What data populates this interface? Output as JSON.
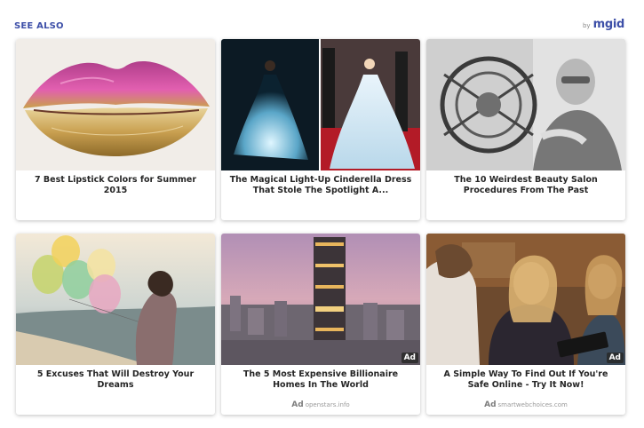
{
  "widget": {
    "heading": "SEE ALSO",
    "by": "by",
    "brand": "mgid",
    "brand_color": "#3d4fa8"
  },
  "cards": [
    {
      "title": "7 Best Lipstick Colors for Summer 2015",
      "ad": false,
      "source": ""
    },
    {
      "title": "The Magical Light-Up Cinderella Dress That Stole The Spotlight A...",
      "ad": false,
      "source": ""
    },
    {
      "title": "The 10 Weirdest Beauty Salon Procedures From The Past",
      "ad": false,
      "source": ""
    },
    {
      "title": "5 Excuses That Will Destroy Your Dreams",
      "ad": false,
      "source": ""
    },
    {
      "title": "The 5 Most Expensive Billionaire Homes In The World",
      "ad": true,
      "ad_label": "Ad",
      "source_ad": "Ad",
      "source": "openstars.info"
    },
    {
      "title": "A Simple Way To Find Out If You're Safe Online - Try It Now!",
      "ad": true,
      "ad_label": "Ad",
      "source_ad": "Ad",
      "source": "smartwebchoices.com"
    }
  ]
}
